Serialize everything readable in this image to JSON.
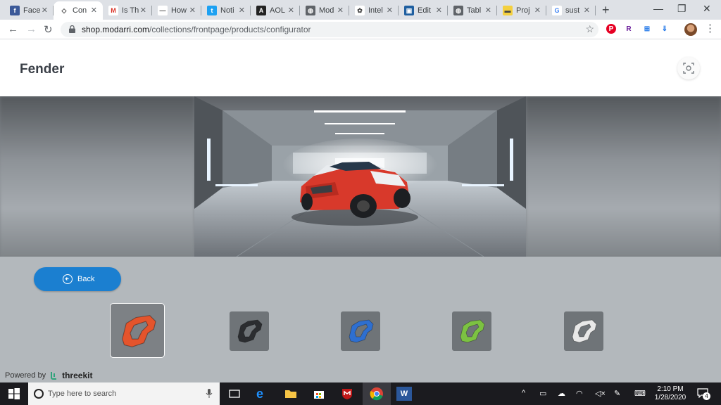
{
  "browser": {
    "tabs": [
      {
        "title": "Face",
        "icon": "facebook-icon",
        "color": "#3b5998",
        "glyph": "f"
      },
      {
        "title": "Con",
        "icon": "diamond-icon",
        "color": "#ffffff",
        "glyph": "◇",
        "active": true
      },
      {
        "title": "Is Th",
        "icon": "gmail-icon",
        "color": "#ffffff",
        "glyph": "M"
      },
      {
        "title": "How",
        "icon": "dash-icon",
        "color": "#ffffff",
        "glyph": "—"
      },
      {
        "title": "Noti",
        "icon": "twitter-icon",
        "color": "#1da1f2",
        "glyph": "t"
      },
      {
        "title": "AOL",
        "icon": "aol-icon",
        "color": "#222222",
        "glyph": "A"
      },
      {
        "title": "Mod",
        "icon": "globe-icon",
        "color": "#5f6368",
        "glyph": "◍"
      },
      {
        "title": "Intel",
        "icon": "intel-icon",
        "color": "#ffffff",
        "glyph": "✿"
      },
      {
        "title": "Edit",
        "icon": "image-icon",
        "color": "#1f5fa0",
        "glyph": "▣"
      },
      {
        "title": "Tabl",
        "icon": "globe-icon",
        "color": "#5f6368",
        "glyph": "◍"
      },
      {
        "title": "Proj",
        "icon": "yellow-icon",
        "color": "#f4d03f",
        "glyph": "▬"
      },
      {
        "title": "sust",
        "icon": "google-icon",
        "color": "#ffffff",
        "glyph": "G"
      }
    ],
    "url_host": "shop.modarri.com",
    "url_path": "/collections/frontpage/products/configurator",
    "extensions": [
      {
        "icon": "pinterest-icon",
        "glyph": "P",
        "color": "#e60023"
      },
      {
        "icon": "r-extension-icon",
        "glyph": "R",
        "color": "#6a1b9a"
      },
      {
        "icon": "extension-icon",
        "glyph": "⊞",
        "color": "#1a73e8"
      },
      {
        "icon": "extension-icon-2",
        "glyph": "⇓",
        "color": "#1a73e8"
      }
    ]
  },
  "page": {
    "title": "Fender",
    "back_label": "Back",
    "powered_by": "Powered by",
    "brand": "threekit",
    "swatches": [
      {
        "name": "red",
        "color": "#e4542c",
        "selected": true
      },
      {
        "name": "black",
        "color": "#2b2d30"
      },
      {
        "name": "blue",
        "color": "#2e6fd0"
      },
      {
        "name": "green",
        "color": "#7cc242"
      },
      {
        "name": "white",
        "color": "#e8e8e8"
      }
    ]
  },
  "taskbar": {
    "search_placeholder": "Type here to search",
    "time": "2:10 PM",
    "date": "1/28/2020",
    "notifications": "4"
  }
}
